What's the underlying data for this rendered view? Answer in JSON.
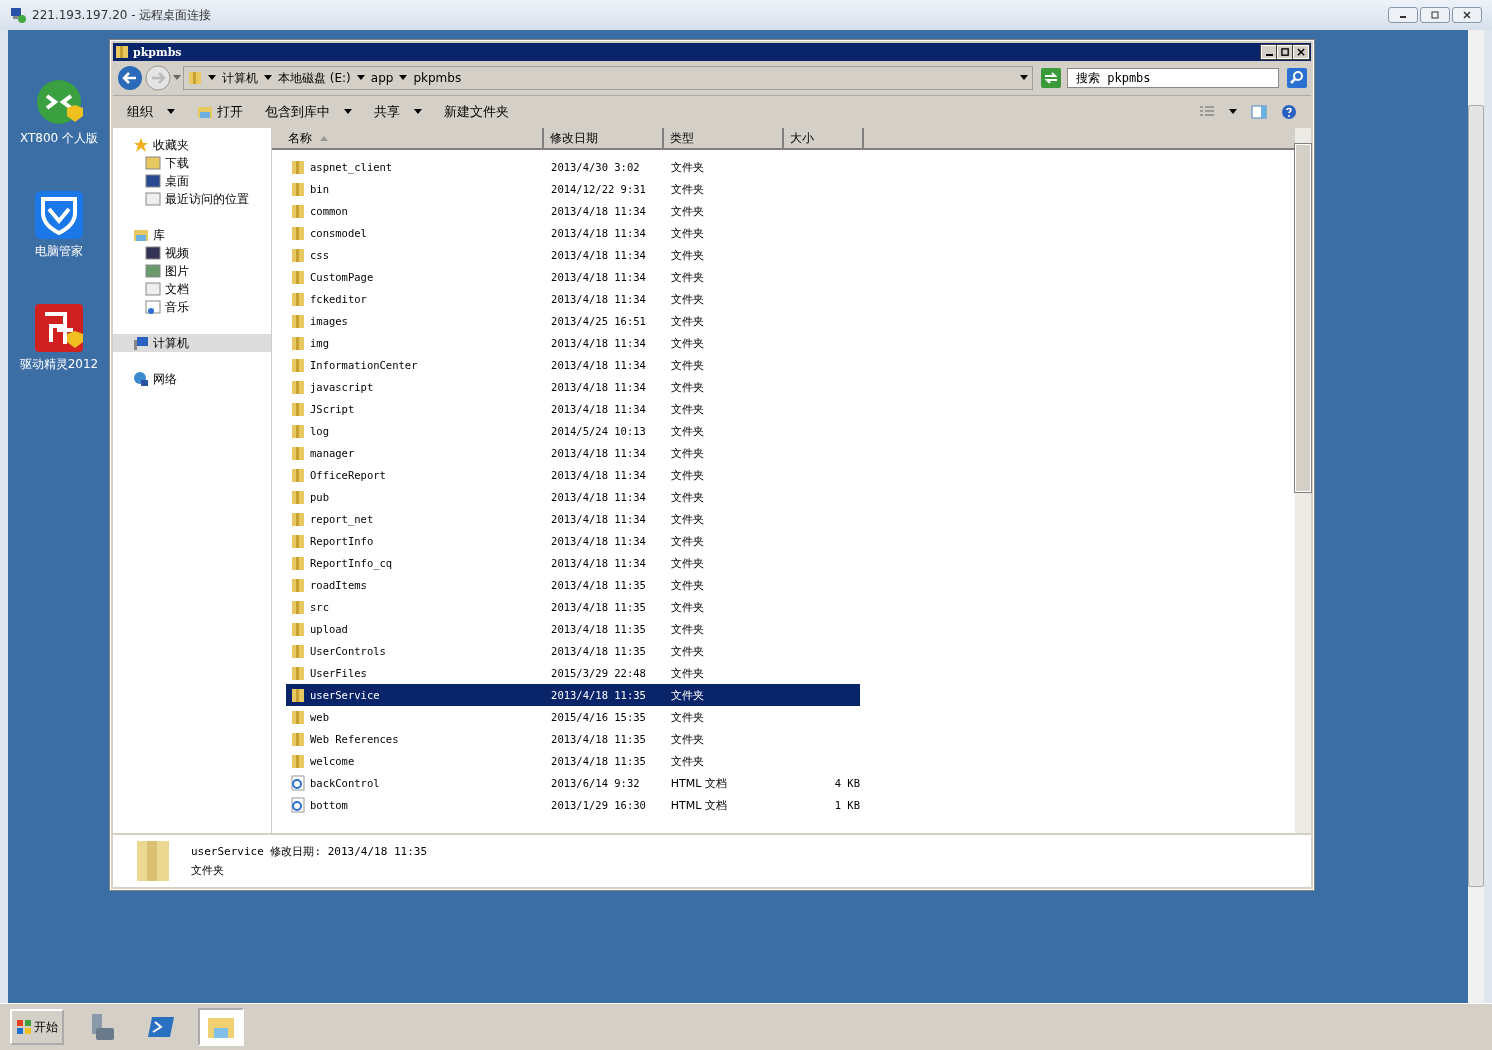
{
  "rdp_window": {
    "title": "221.193.197.20 - 远程桌面连接"
  },
  "desktop_icons": [
    {
      "label": "XT800 个人版",
      "kind": "remote"
    },
    {
      "label": "电脑管家",
      "kind": "shield"
    },
    {
      "label": "驱动精灵2012",
      "kind": "driver"
    }
  ],
  "explorer": {
    "title": "pkpmbs",
    "breadcrumb": [
      "计算机",
      "本地磁盘 (E:)",
      "app",
      "pkpmbs"
    ],
    "search": {
      "placeholder": "搜索 pkpmbs"
    },
    "toolbar": [
      {
        "label": "组织",
        "dropdown": true,
        "icon": false
      },
      {
        "label": "打开",
        "dropdown": false,
        "icon": true
      },
      {
        "label": "包含到库中",
        "dropdown": true,
        "icon": false
      },
      {
        "label": "共享",
        "dropdown": true,
        "icon": false
      },
      {
        "label": "新建文件夹",
        "dropdown": false,
        "icon": false
      }
    ],
    "nav": [
      {
        "label": "收藏夹",
        "kind": "star",
        "selected": false,
        "children": [
          {
            "label": "下载",
            "kind": "download"
          },
          {
            "label": "桌面",
            "kind": "desktop"
          },
          {
            "label": "最近访问的位置",
            "kind": "recent"
          }
        ]
      },
      {
        "label": "库",
        "kind": "library",
        "selected": false,
        "children": [
          {
            "label": "视频",
            "kind": "video"
          },
          {
            "label": "图片",
            "kind": "image"
          },
          {
            "label": "文档",
            "kind": "doc"
          },
          {
            "label": "音乐",
            "kind": "music"
          }
        ]
      },
      {
        "label": "计算机",
        "kind": "computer",
        "selected": true
      },
      {
        "label": "网络",
        "kind": "network",
        "selected": false
      }
    ],
    "columns": [
      "名称",
      "修改日期",
      "类型",
      "大小"
    ],
    "files": [
      {
        "name": "aspnet_client",
        "date": "2013/4/30 3:02",
        "type": "文件夹",
        "kind": "folder",
        "selected": false
      },
      {
        "name": "bin",
        "date": "2014/12/22 9:31",
        "type": "文件夹",
        "kind": "folder",
        "selected": false
      },
      {
        "name": "common",
        "date": "2013/4/18 11:34",
        "type": "文件夹",
        "kind": "folder",
        "selected": false
      },
      {
        "name": "consmodel",
        "date": "2013/4/18 11:34",
        "type": "文件夹",
        "kind": "folder",
        "selected": false
      },
      {
        "name": "css",
        "date": "2013/4/18 11:34",
        "type": "文件夹",
        "kind": "folder",
        "selected": false
      },
      {
        "name": "CustomPage",
        "date": "2013/4/18 11:34",
        "type": "文件夹",
        "kind": "folder",
        "selected": false
      },
      {
        "name": "fckeditor",
        "date": "2013/4/18 11:34",
        "type": "文件夹",
        "kind": "folder",
        "selected": false
      },
      {
        "name": "images",
        "date": "2013/4/25 16:51",
        "type": "文件夹",
        "kind": "folder",
        "selected": false
      },
      {
        "name": "img",
        "date": "2013/4/18 11:34",
        "type": "文件夹",
        "kind": "folder",
        "selected": false
      },
      {
        "name": "InformationCenter",
        "date": "2013/4/18 11:34",
        "type": "文件夹",
        "kind": "folder",
        "selected": false
      },
      {
        "name": "javascript",
        "date": "2013/4/18 11:34",
        "type": "文件夹",
        "kind": "folder",
        "selected": false
      },
      {
        "name": "JScript",
        "date": "2013/4/18 11:34",
        "type": "文件夹",
        "kind": "folder",
        "selected": false
      },
      {
        "name": "log",
        "date": "2014/5/24 10:13",
        "type": "文件夹",
        "kind": "folder",
        "selected": false
      },
      {
        "name": "manager",
        "date": "2013/4/18 11:34",
        "type": "文件夹",
        "kind": "folder",
        "selected": false
      },
      {
        "name": "OfficeReport",
        "date": "2013/4/18 11:34",
        "type": "文件夹",
        "kind": "folder",
        "selected": false
      },
      {
        "name": "pub",
        "date": "2013/4/18 11:34",
        "type": "文件夹",
        "kind": "folder",
        "selected": false
      },
      {
        "name": "report_net",
        "date": "2013/4/18 11:34",
        "type": "文件夹",
        "kind": "folder",
        "selected": false
      },
      {
        "name": "ReportInfo",
        "date": "2013/4/18 11:34",
        "type": "文件夹",
        "kind": "folder",
        "selected": false
      },
      {
        "name": "ReportInfo_cq",
        "date": "2013/4/18 11:34",
        "type": "文件夹",
        "kind": "folder",
        "selected": false
      },
      {
        "name": "roadItems",
        "date": "2013/4/18 11:35",
        "type": "文件夹",
        "kind": "folder",
        "selected": false
      },
      {
        "name": "src",
        "date": "2013/4/18 11:35",
        "type": "文件夹",
        "kind": "folder",
        "selected": false
      },
      {
        "name": "upload",
        "date": "2013/4/18 11:35",
        "type": "文件夹",
        "kind": "folder",
        "selected": false
      },
      {
        "name": "UserControls",
        "date": "2013/4/18 11:35",
        "type": "文件夹",
        "kind": "folder",
        "selected": false
      },
      {
        "name": "UserFiles",
        "date": "2015/3/29 22:48",
        "type": "文件夹",
        "kind": "folder",
        "selected": false
      },
      {
        "name": "userService",
        "date": "2013/4/18 11:35",
        "type": "文件夹",
        "kind": "folder",
        "selected": true
      },
      {
        "name": "web",
        "date": "2015/4/16 15:35",
        "type": "文件夹",
        "kind": "folder",
        "selected": false
      },
      {
        "name": "Web References",
        "date": "2013/4/18 11:35",
        "type": "文件夹",
        "kind": "folder",
        "selected": false
      },
      {
        "name": "welcome",
        "date": "2013/4/18 11:35",
        "type": "文件夹",
        "kind": "folder",
        "selected": false
      },
      {
        "name": "backControl",
        "date": "2013/6/14 9:32",
        "type": "HTML 文档",
        "size": "4 KB",
        "kind": "html",
        "selected": false
      },
      {
        "name": "bottom",
        "date": "2013/1/29 16:30",
        "type": "HTML 文档",
        "size": "1 KB",
        "kind": "html",
        "selected": false
      }
    ],
    "details": {
      "name": "userService",
      "modified": "修改日期: 2013/4/18 11:35",
      "type": "文件夹"
    }
  },
  "taskbar": {
    "start": "开始",
    "apps": [
      {
        "kind": "server",
        "selected": false
      },
      {
        "kind": "powershell",
        "selected": false
      },
      {
        "kind": "explorer",
        "selected": true
      }
    ]
  }
}
